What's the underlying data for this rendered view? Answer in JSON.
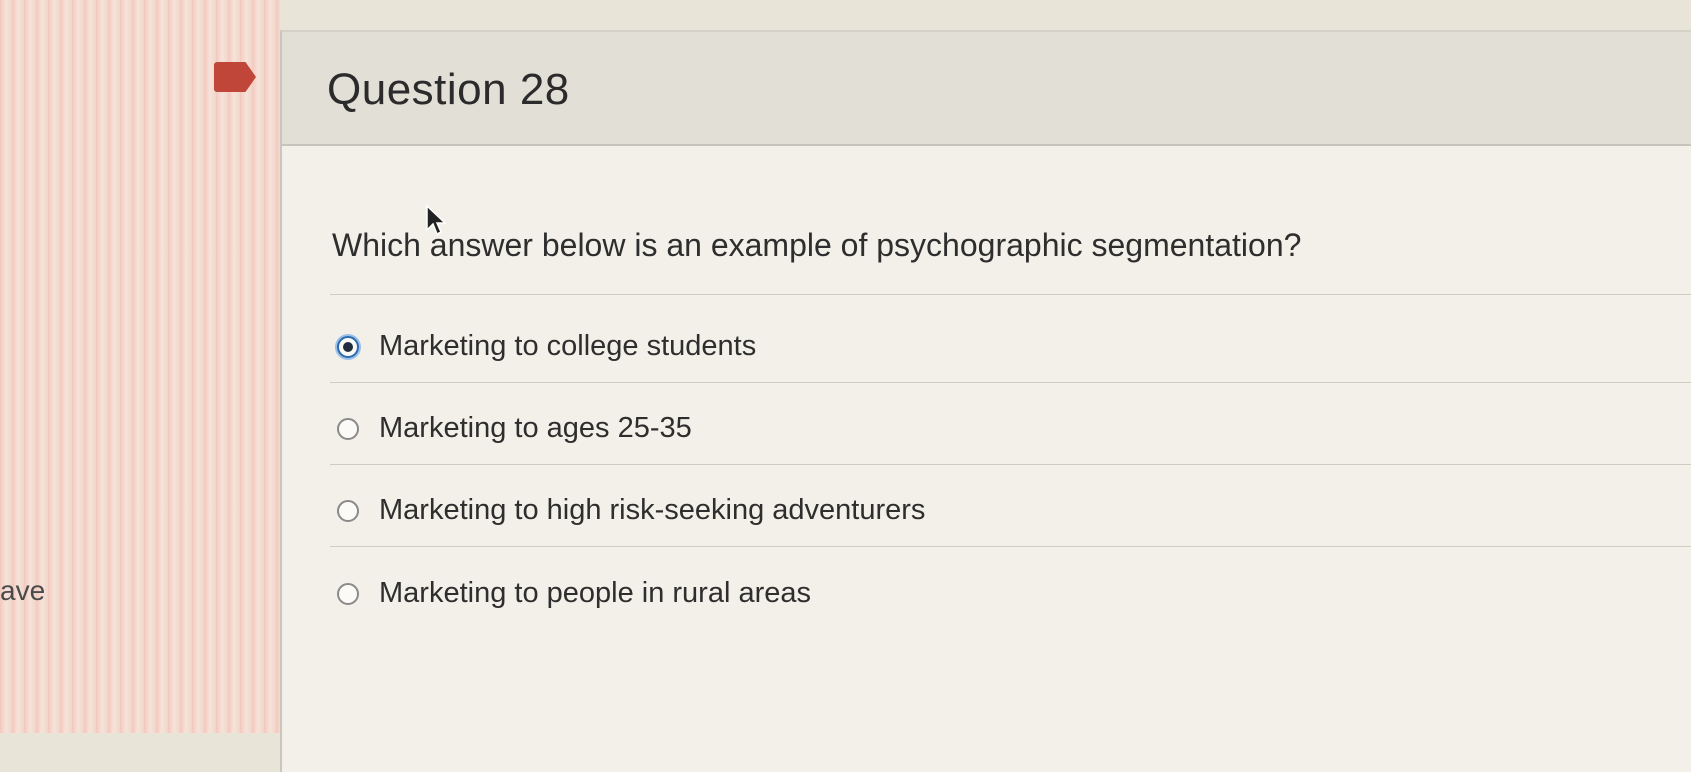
{
  "sidebar": {
    "partial_text": "ave"
  },
  "question": {
    "title": "Question 28",
    "text": "Which answer below is an example of psychographic segmentation?",
    "options": [
      {
        "label": "Marketing to college students",
        "selected": true
      },
      {
        "label": "Marketing to ages 25-35",
        "selected": false
      },
      {
        "label": "Marketing to high risk-seeking adventurers",
        "selected": false
      },
      {
        "label": "Marketing to people in rural areas",
        "selected": false
      }
    ]
  },
  "colors": {
    "flag": "#c0463a",
    "selected_radio": "#2b6cb0"
  },
  "icons": {
    "flag": "bookmark-flag-icon",
    "cursor": "mouse-pointer-icon"
  }
}
